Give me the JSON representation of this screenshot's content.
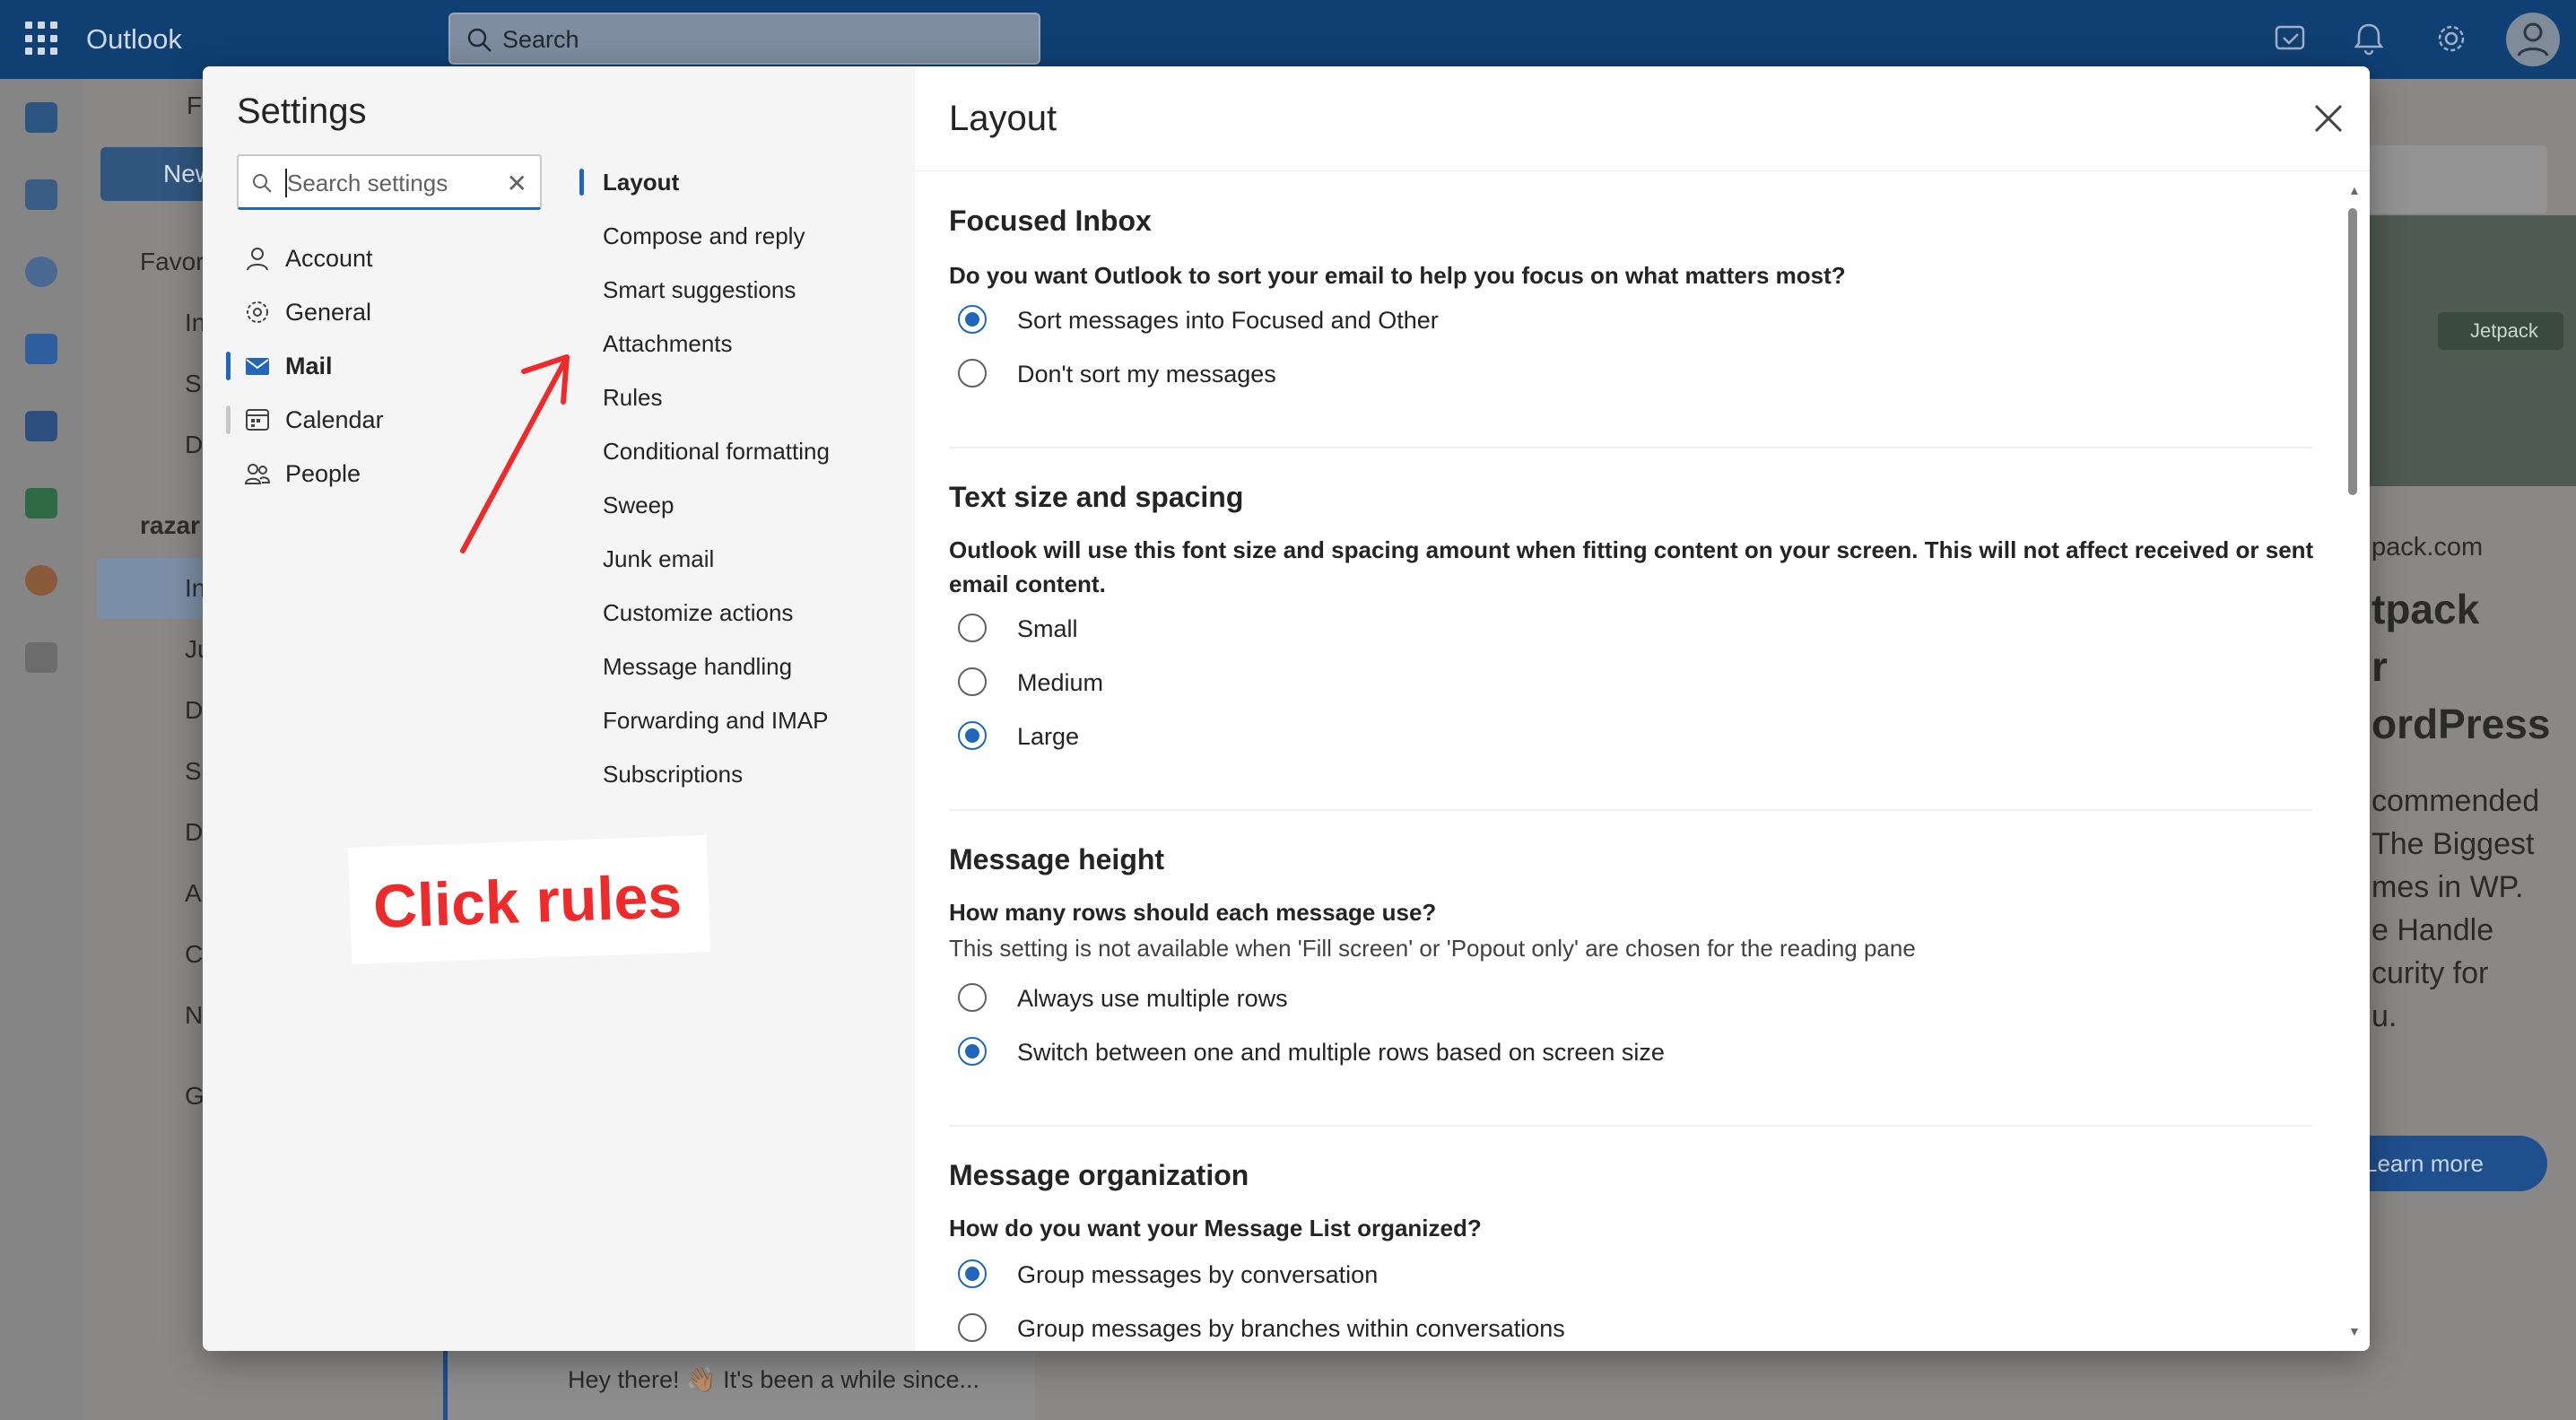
{
  "app": {
    "brand": "Outlook",
    "search_placeholder": "Search"
  },
  "background": {
    "new_button": "New",
    "folder_stubs": [
      "Fi",
      "Favor",
      "In",
      "Se",
      "D",
      "razar",
      "In",
      "Ju",
      "D",
      "Se",
      "D",
      "A",
      "C",
      "N",
      "G"
    ],
    "ad": {
      "badge": "Jetpack",
      "domain": "pack.com",
      "headline": [
        "tpack",
        "r",
        "ordPress"
      ],
      "body": [
        "commended",
        "The Biggest",
        "mes in WP.",
        "e Handle",
        "curity for",
        "u."
      ],
      "cta": "Learn more"
    },
    "message_preview": "Hey there! 👋🏽 It's been a while since..."
  },
  "settings": {
    "title": "Settings",
    "search_placeholder": "Search settings",
    "categories": [
      {
        "label": "Account",
        "icon": "person-icon"
      },
      {
        "label": "General",
        "icon": "gear-icon"
      },
      {
        "label": "Mail",
        "icon": "mail-icon"
      },
      {
        "label": "Calendar",
        "icon": "calendar-icon"
      },
      {
        "label": "People",
        "icon": "people-icon"
      }
    ],
    "selected_category": "Mail",
    "subnav": [
      "Layout",
      "Compose and reply",
      "Smart suggestions",
      "Attachments",
      "Rules",
      "Conditional formatting",
      "Sweep",
      "Junk email",
      "Customize actions",
      "Message handling",
      "Forwarding and IMAP",
      "Subscriptions"
    ],
    "selected_subnav": "Layout",
    "annotation": "Click rules",
    "annotation_color": "#ee2a2a"
  },
  "layout_page": {
    "title": "Layout",
    "sections": [
      {
        "title": "Focused Inbox",
        "question": "Do you want Outlook to sort your email to help you focus on what matters most?",
        "options": [
          {
            "label": "Sort messages into Focused and Other",
            "selected": true
          },
          {
            "label": "Don't sort my messages",
            "selected": false
          }
        ]
      },
      {
        "title": "Text size and spacing",
        "question": "Outlook will use this font size and spacing amount when fitting content on your screen. This will not affect received or sent email content.",
        "options": [
          {
            "label": "Small",
            "selected": false
          },
          {
            "label": "Medium",
            "selected": false
          },
          {
            "label": "Large",
            "selected": true
          }
        ]
      },
      {
        "title": "Message height",
        "question": "How many rows should each message use?",
        "note": "This setting is not available when 'Fill screen' or 'Popout only' are chosen for the reading pane",
        "options": [
          {
            "label": "Always use multiple rows",
            "selected": false
          },
          {
            "label": "Switch between one and multiple rows based on screen size",
            "selected": true
          }
        ]
      },
      {
        "title": "Message organization",
        "question": "How do you want your Message List organized?",
        "options": [
          {
            "label": "Group messages by conversation",
            "selected": true
          },
          {
            "label": "Group messages by branches within conversations",
            "selected": false
          }
        ]
      }
    ]
  },
  "colors": {
    "accent": "#2166b8",
    "header": "#0f3f73"
  }
}
